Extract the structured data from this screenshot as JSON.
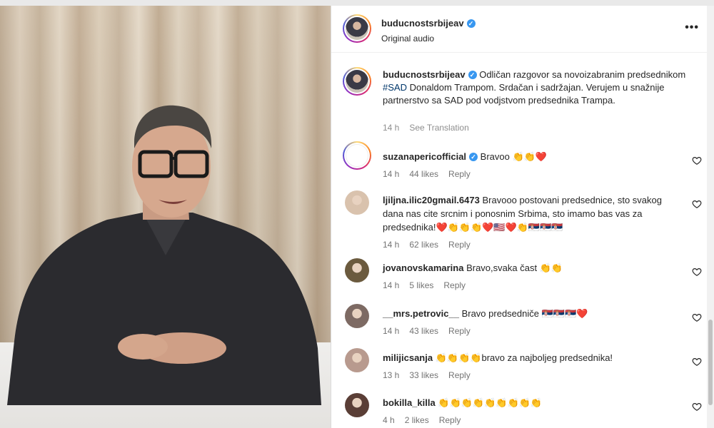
{
  "post": {
    "author": "buducnostsrbijeav",
    "audio": "Original audio",
    "more_label": "•••",
    "caption_before_tag": "Odličan razgovor sa novoizabranim predsednikom ",
    "hashtag": "#SAD",
    "caption_after_tag": " Donaldom Trampom. Srdačan i sadržajan. Verujem u snažnije partnerstvo sa SAD pod vodjstvom predsednika Trampa.",
    "time": "14 h",
    "translation": "See Translation"
  },
  "comments": [
    {
      "user": "suzanapericofficial",
      "verified": true,
      "text": "Bravoo 👏👏❤️",
      "time": "14 h",
      "likes": "44 likes",
      "reply": "Reply",
      "avatar_color": "#ffffff"
    },
    {
      "user": "ljiljna.ilic20gmail.6473",
      "verified": false,
      "text": "Bravooo postovani predsednice, sto svakog dana nas cite srcnim i ponosnim Srbima, sto imamo bas vas za predsednika!❤️👏👏👏❤️🇺🇸❤️👏🇷🇸🇷🇸🇷🇸",
      "time": "14 h",
      "likes": "62 likes",
      "reply": "Reply",
      "avatar_color": "#d9c2ad"
    },
    {
      "user": "jovanovskamarina",
      "verified": false,
      "text": "Bravo,svaka čast 👏👏",
      "time": "14 h",
      "likes": "5 likes",
      "reply": "Reply",
      "avatar_color": "#6b5a3e"
    },
    {
      "user": "__mrs.petrovic__",
      "verified": false,
      "text": "Bravo predsedniče 🇷🇸🇷🇸🇷🇸❤️",
      "time": "14 h",
      "likes": "43 likes",
      "reply": "Reply",
      "avatar_color": "#7d6a63"
    },
    {
      "user": "milijicsanja",
      "verified": false,
      "text": "👏👏👏👏bravo za najboljeg predsednika!",
      "time": "13 h",
      "likes": "33 likes",
      "reply": "Reply",
      "avatar_color": "#b89a8e"
    },
    {
      "user": "bokilla_killa",
      "verified": false,
      "text": "👏👏👏👏👏👏👏👏👏",
      "time": "4 h",
      "likes": "2 likes",
      "reply": "Reply",
      "avatar_color": "#5a3e36"
    }
  ],
  "icons": {
    "verified": "verified-badge-icon",
    "heart": "heart-outline-icon",
    "more": "more-options-icon"
  },
  "colors": {
    "verified": "#3897f0",
    "hashtag": "#00376b",
    "meta": "#8e8e8e"
  }
}
